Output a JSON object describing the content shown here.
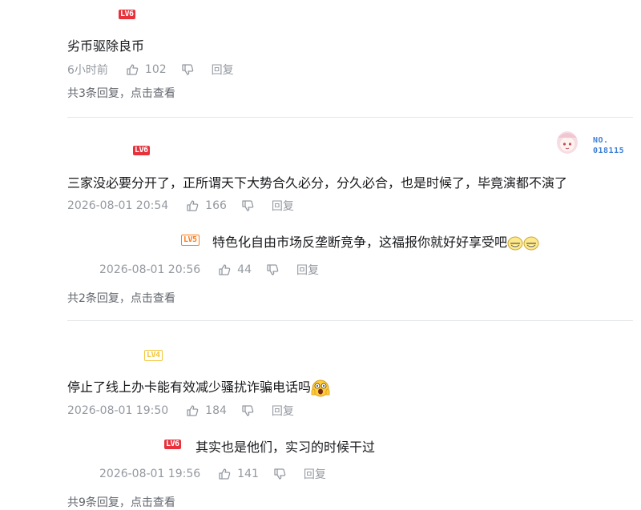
{
  "comments": [
    {
      "level": "LV6",
      "text": "劣币驱除良币",
      "time": "6小时前",
      "likes": "102",
      "reply_label": "回复",
      "more": {
        "prefix": "共3条回复，",
        "link": "点击查看"
      }
    },
    {
      "level": "LV6",
      "text": "三家没必要分开了，正所谓天下大势合久必分，分久必合，也是时候了，毕竟演都不演了",
      "time": "2026-08-01 20:54",
      "likes": "166",
      "reply_label": "回复",
      "badge": {
        "line1": "NO.",
        "line2": "018115"
      },
      "replies": [
        {
          "level": "LV5",
          "text": "特色化自由市场反垄断竞争，这福报你就好好享受吧",
          "time": "2026-08-01 20:56",
          "likes": "44",
          "reply_label": "回复"
        }
      ],
      "more": {
        "prefix": "共2条回复，",
        "link": "点击查看"
      }
    },
    {
      "level": "LV4",
      "text": "停止了线上办卡能有效减少骚扰诈骗电话吗",
      "time": "2026-08-01 19:50",
      "likes": "184",
      "reply_label": "回复",
      "replies": [
        {
          "level": "LV6",
          "text": "其实也是他们，实习的时候干过",
          "time": "2026-08-01 19:56",
          "likes": "141",
          "reply_label": "回复"
        }
      ],
      "more": {
        "prefix": "共9条回复，",
        "link": "点击查看"
      }
    }
  ],
  "colors": {
    "text": "#18191c",
    "meta": "#9499a0",
    "level_red": "#e8313b",
    "level_orange": "#ff7b1a",
    "level_yellow": "#f3c63a",
    "badge_blue": "#3d7fd6"
  },
  "icons": [
    "thumb-up-icon",
    "thumb-down-icon",
    "shocked-emoji-icon",
    "grin-emoji-icon"
  ]
}
